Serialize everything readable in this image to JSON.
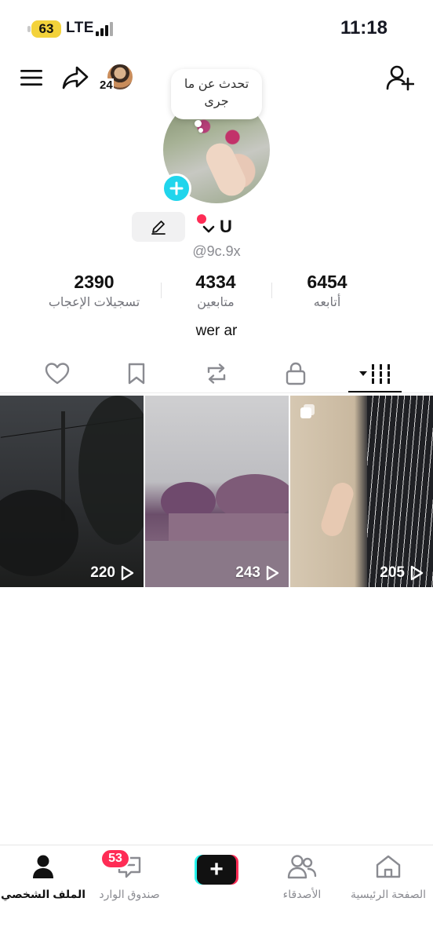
{
  "status_bar": {
    "battery": "63",
    "network": "LTE",
    "time": "11:18"
  },
  "header": {
    "story_count": "24"
  },
  "note": {
    "text": "تحدث عن ما جرى"
  },
  "profile": {
    "display_name": "U",
    "username": "@9c.9x",
    "bio": "wer ar"
  },
  "stats": [
    {
      "value": "2390",
      "label": "تسجيلات الإعجاب"
    },
    {
      "value": "4334",
      "label": "متابعين"
    },
    {
      "value": "6454",
      "label": "أتابعه"
    }
  ],
  "tabs": {
    "icons": [
      "heart-icon",
      "bookmark-icon",
      "repost-icon",
      "lock-icon",
      "grid-icon"
    ],
    "active": "grid-icon"
  },
  "videos": [
    {
      "plays": "220"
    },
    {
      "plays": "243"
    },
    {
      "plays": "205"
    }
  ],
  "bottom_nav": {
    "profile": "الملف الشخصي",
    "inbox": "صندوق الوارد",
    "inbox_badge": "53",
    "create": "+",
    "friends": "الأصدقاء",
    "home": "الصفحة الرئيسية"
  },
  "colors": {
    "accent": "#fe2c55",
    "cyan": "#25f4ee",
    "add_blue": "#20d5ec"
  }
}
